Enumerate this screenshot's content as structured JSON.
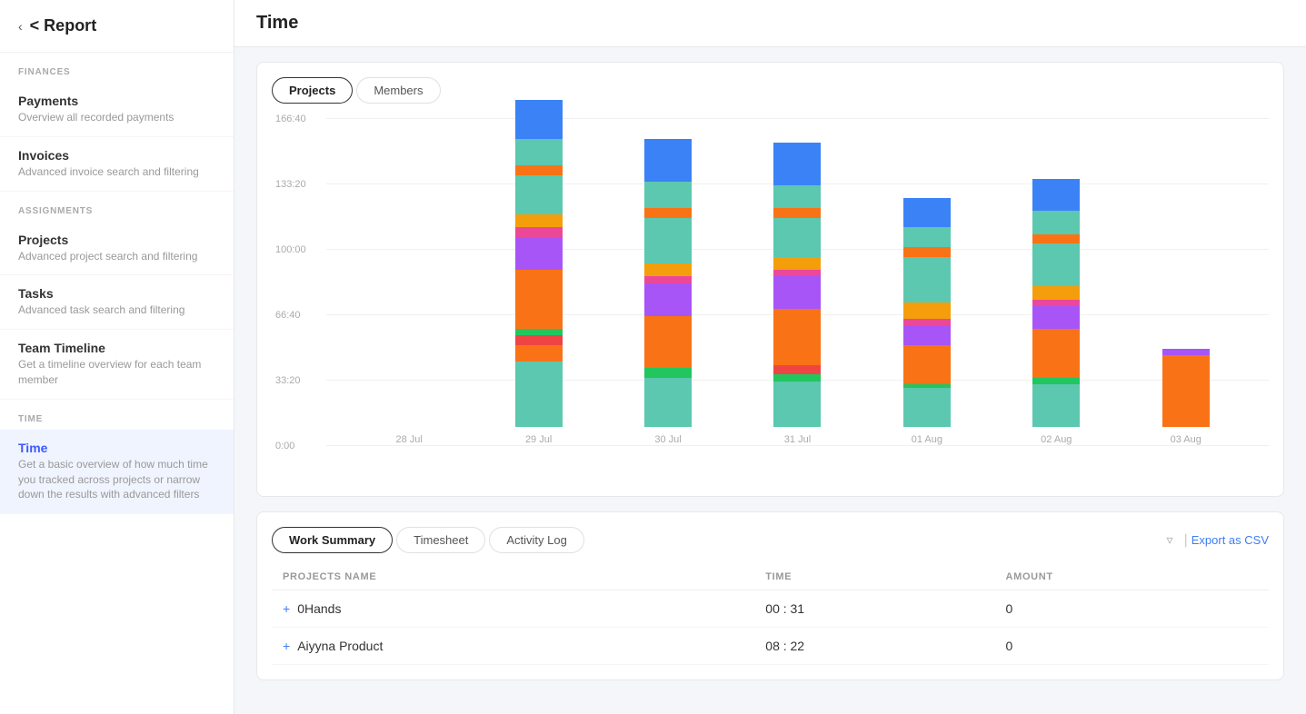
{
  "sidebar": {
    "back_label": "< Report",
    "sections": [
      {
        "label": "FINANCES",
        "items": [
          {
            "id": "payments",
            "title": "Payments",
            "desc": "Overview all recorded payments",
            "active": false
          },
          {
            "id": "invoices",
            "title": "Invoices",
            "desc": "Advanced invoice search and filtering",
            "active": false
          }
        ]
      },
      {
        "label": "ASSIGNMENTS",
        "items": [
          {
            "id": "projects",
            "title": "Projects",
            "desc": "Advanced project search and filtering",
            "active": false
          },
          {
            "id": "tasks",
            "title": "Tasks",
            "desc": "Advanced task search and filtering",
            "active": false
          },
          {
            "id": "team-timeline",
            "title": "Team Timeline",
            "desc": "Get a timeline overview for each team member",
            "active": false
          }
        ]
      },
      {
        "label": "TIME",
        "items": [
          {
            "id": "time",
            "title": "Time",
            "desc": "Get a basic overview of how much time you tracked across projects or narrow down the results with advanced filters",
            "active": true
          }
        ]
      }
    ]
  },
  "main": {
    "title": "Time",
    "chart_tabs": [
      {
        "label": "Projects",
        "active": true
      },
      {
        "label": "Members",
        "active": false
      }
    ],
    "chart": {
      "y_labels": [
        "166:40",
        "133:20",
        "100:00",
        "66:40",
        "33:20",
        "0:00"
      ],
      "bars": [
        {
          "label": "28 Jul",
          "segments": [],
          "total_pct": 0
        },
        {
          "label": "29 Jul",
          "segments": [
            {
              "color": "#5bc8af",
              "pct": 20
            },
            {
              "color": "#f97316",
              "pct": 5
            },
            {
              "color": "#ef4444",
              "pct": 3
            },
            {
              "color": "#22c55e",
              "pct": 2
            },
            {
              "color": "#f97316",
              "pct": 18
            },
            {
              "color": "#a855f7",
              "pct": 10
            },
            {
              "color": "#ec4899",
              "pct": 3
            },
            {
              "color": "#f59e0b",
              "pct": 4
            },
            {
              "color": "#5bc8af",
              "pct": 12
            },
            {
              "color": "#f97316",
              "pct": 3
            },
            {
              "color": "#5bc8af",
              "pct": 8
            },
            {
              "color": "#3b82f6",
              "pct": 12
            }
          ],
          "total_pct": 100
        },
        {
          "label": "30 Jul",
          "segments": [
            {
              "color": "#5bc8af",
              "pct": 15
            },
            {
              "color": "#22c55e",
              "pct": 3
            },
            {
              "color": "#f97316",
              "pct": 16
            },
            {
              "color": "#a855f7",
              "pct": 10
            },
            {
              "color": "#ec4899",
              "pct": 2
            },
            {
              "color": "#f59e0b",
              "pct": 4
            },
            {
              "color": "#5bc8af",
              "pct": 14
            },
            {
              "color": "#f97316",
              "pct": 3
            },
            {
              "color": "#5bc8af",
              "pct": 8
            },
            {
              "color": "#3b82f6",
              "pct": 13
            }
          ],
          "total_pct": 88
        },
        {
          "label": "31 Jul",
          "segments": [
            {
              "color": "#5bc8af",
              "pct": 14
            },
            {
              "color": "#22c55e",
              "pct": 2
            },
            {
              "color": "#ef4444",
              "pct": 3
            },
            {
              "color": "#f97316",
              "pct": 17
            },
            {
              "color": "#a855f7",
              "pct": 10
            },
            {
              "color": "#ec4899",
              "pct": 2
            },
            {
              "color": "#f59e0b",
              "pct": 4
            },
            {
              "color": "#5bc8af",
              "pct": 12
            },
            {
              "color": "#f97316",
              "pct": 3
            },
            {
              "color": "#5bc8af",
              "pct": 7
            },
            {
              "color": "#3b82f6",
              "pct": 13
            }
          ],
          "total_pct": 87
        },
        {
          "label": "01 Aug",
          "segments": [
            {
              "color": "#5bc8af",
              "pct": 12
            },
            {
              "color": "#22c55e",
              "pct": 1
            },
            {
              "color": "#f97316",
              "pct": 12
            },
            {
              "color": "#a855f7",
              "pct": 6
            },
            {
              "color": "#ec4899",
              "pct": 2
            },
            {
              "color": "#f59e0b",
              "pct": 5
            },
            {
              "color": "#5bc8af",
              "pct": 14
            },
            {
              "color": "#f97316",
              "pct": 3
            },
            {
              "color": "#5bc8af",
              "pct": 6
            },
            {
              "color": "#3b82f6",
              "pct": 9
            }
          ],
          "total_pct": 70
        },
        {
          "label": "02 Aug",
          "segments": [
            {
              "color": "#5bc8af",
              "pct": 13
            },
            {
              "color": "#22c55e",
              "pct": 2
            },
            {
              "color": "#f97316",
              "pct": 15
            },
            {
              "color": "#a855f7",
              "pct": 7
            },
            {
              "color": "#ec4899",
              "pct": 2
            },
            {
              "color": "#f59e0b",
              "pct": 4
            },
            {
              "color": "#5bc8af",
              "pct": 13
            },
            {
              "color": "#f97316",
              "pct": 3
            },
            {
              "color": "#5bc8af",
              "pct": 7
            },
            {
              "color": "#3b82f6",
              "pct": 10
            }
          ],
          "total_pct": 76
        },
        {
          "label": "03 Aug",
          "segments": [
            {
              "color": "#f97316",
              "pct": 22
            },
            {
              "color": "#a855f7",
              "pct": 2
            }
          ],
          "total_pct": 24
        }
      ]
    },
    "bottom_tabs": [
      {
        "label": "Work Summary",
        "active": true
      },
      {
        "label": "Timesheet",
        "active": false
      },
      {
        "label": "Activity Log",
        "active": false
      }
    ],
    "table": {
      "columns": [
        "PROJECTS NAME",
        "TIME",
        "AMOUNT"
      ],
      "rows": [
        {
          "expand": true,
          "name": "0Hands",
          "time": "00 : 31",
          "amount": "0"
        },
        {
          "expand": true,
          "name": "Aiyyna Product",
          "time": "08 : 22",
          "amount": "0"
        }
      ]
    },
    "export_label": "Export as CSV",
    "filter_icon": "▼"
  }
}
